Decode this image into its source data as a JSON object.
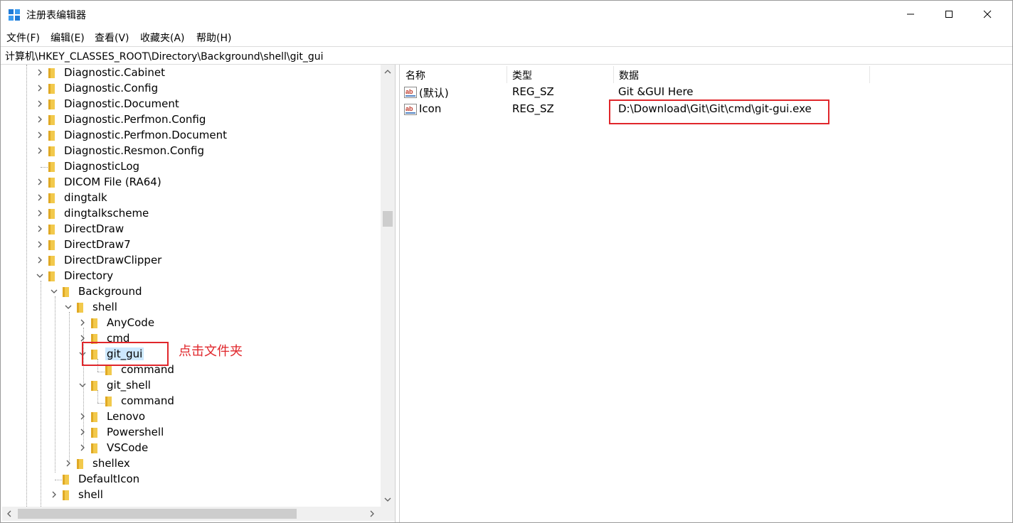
{
  "window": {
    "title": "注册表编辑器",
    "controls": {
      "minimize": "minimize",
      "maximize": "maximize",
      "close": "close"
    }
  },
  "menu": [
    "文件(F)",
    "编辑(E)",
    "查看(V)",
    "收藏夹(A)",
    "帮助(H)"
  ],
  "address": "计算机\\HKEY_CLASSES_ROOT\\Directory\\Background\\shell\\git_gui",
  "tree": {
    "items": [
      {
        "label": "Diagnostic.Cabinet",
        "expander": "collapsed"
      },
      {
        "label": "Diagnostic.Config",
        "expander": "collapsed"
      },
      {
        "label": "Diagnostic.Document",
        "expander": "collapsed"
      },
      {
        "label": "Diagnostic.Perfmon.Config",
        "expander": "collapsed"
      },
      {
        "label": "Diagnostic.Perfmon.Document",
        "expander": "collapsed"
      },
      {
        "label": "Diagnostic.Resmon.Config",
        "expander": "collapsed"
      },
      {
        "label": "DiagnosticLog",
        "expander": "none"
      },
      {
        "label": "DICOM File (RA64)",
        "expander": "collapsed"
      },
      {
        "label": "dingtalk",
        "expander": "collapsed"
      },
      {
        "label": "dingtalkscheme",
        "expander": "collapsed"
      },
      {
        "label": "DirectDraw",
        "expander": "collapsed"
      },
      {
        "label": "DirectDraw7",
        "expander": "collapsed"
      },
      {
        "label": "DirectDrawClipper",
        "expander": "collapsed"
      },
      {
        "label": "Directory",
        "expander": "expanded"
      },
      {
        "label": "Background",
        "expander": "expanded"
      },
      {
        "label": "shell",
        "expander": "expanded"
      },
      {
        "label": "AnyCode",
        "expander": "collapsed"
      },
      {
        "label": "cmd",
        "expander": "collapsed"
      },
      {
        "label": "git_gui",
        "expander": "expanded",
        "selected": true
      },
      {
        "label": "command",
        "expander": "none"
      },
      {
        "label": "git_shell",
        "expander": "expanded"
      },
      {
        "label": "command",
        "expander": "none"
      },
      {
        "label": "Lenovo",
        "expander": "collapsed"
      },
      {
        "label": "Powershell",
        "expander": "collapsed"
      },
      {
        "label": "VSCode",
        "expander": "collapsed"
      },
      {
        "label": "shellex",
        "expander": "collapsed"
      },
      {
        "label": "DefaultIcon",
        "expander": "none"
      },
      {
        "label": "shell",
        "expander": "collapsed"
      }
    ]
  },
  "list": {
    "columns": [
      "名称",
      "类型",
      "数据"
    ],
    "rows": [
      {
        "name": "(默认)",
        "type": "REG_SZ",
        "data": "Git &GUI Here",
        "icon": "string-value-icon"
      },
      {
        "name": "Icon",
        "type": "REG_SZ",
        "data": "D:\\Download\\Git\\Git\\cmd\\git-gui.exe",
        "icon": "string-value-icon"
      }
    ]
  },
  "annotation": {
    "text": "点击文件夹",
    "color": "#e0262b"
  },
  "colors": {
    "selection": "#cce8ff",
    "folder": "#f2c94c",
    "highlight": "#e0262b"
  }
}
